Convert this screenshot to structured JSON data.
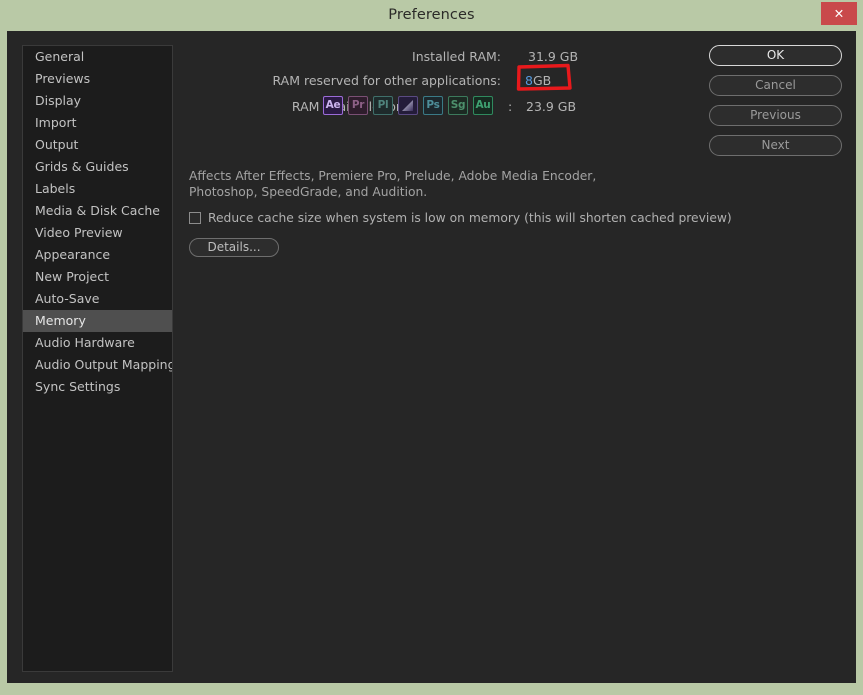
{
  "window": {
    "title": "Preferences",
    "close_label": "✕",
    "titlebar_color": "#b9c9a6",
    "body_color": "#262626"
  },
  "sidebar": {
    "items": [
      {
        "label": "General",
        "selected": false
      },
      {
        "label": "Previews",
        "selected": false
      },
      {
        "label": "Display",
        "selected": false
      },
      {
        "label": "Import",
        "selected": false
      },
      {
        "label": "Output",
        "selected": false
      },
      {
        "label": "Grids & Guides",
        "selected": false
      },
      {
        "label": "Labels",
        "selected": false
      },
      {
        "label": "Media & Disk Cache",
        "selected": false
      },
      {
        "label": "Video Preview",
        "selected": false
      },
      {
        "label": "Appearance",
        "selected": false
      },
      {
        "label": "New Project",
        "selected": false
      },
      {
        "label": "Auto-Save",
        "selected": false
      },
      {
        "label": "Memory",
        "selected": true
      },
      {
        "label": "Audio Hardware",
        "selected": false
      },
      {
        "label": "Audio Output Mapping",
        "selected": false
      },
      {
        "label": "Sync Settings",
        "selected": false
      }
    ]
  },
  "buttons": {
    "ok": "OK",
    "cancel": "Cancel",
    "previous": "Previous",
    "next": "Next"
  },
  "memory": {
    "installed_label": "Installed RAM:",
    "installed_value": "31.9 GB",
    "reserved_label": "RAM reserved for other applications:",
    "reserved_number": "8",
    "reserved_unit": "GB",
    "reserved_number_color": "#5599dd",
    "available_label": "RAM available for",
    "available_colon": ":",
    "available_value": "23.9 GB",
    "app_badges": [
      {
        "name": "after-effects",
        "text": "Ae",
        "border": "#9b6bd8",
        "fill": "#2b1a44",
        "color": "#cbb4ee",
        "active": true,
        "gradient": false
      },
      {
        "name": "premiere-pro",
        "text": "Pr",
        "border": "#7a4f74",
        "fill": "#2e1d2c",
        "color": "#8d6086",
        "active": false,
        "gradient": false
      },
      {
        "name": "prelude",
        "text": "Pl",
        "border": "#3f6f6a",
        "fill": "#1e2a2b",
        "color": "#4f837c",
        "active": false,
        "gradient": false
      },
      {
        "name": "media-encoder",
        "text": "",
        "border": "#5a4a82",
        "fill": "#241c3a",
        "color": "#9a8fc4",
        "active": false,
        "gradient": true
      },
      {
        "name": "photoshop",
        "text": "Ps",
        "border": "#3a7a86",
        "fill": "#1c272c",
        "color": "#4e8e99",
        "active": false,
        "gradient": false
      },
      {
        "name": "speedgrade",
        "text": "Sg",
        "border": "#3c7a5c",
        "fill": "#1c2a23",
        "color": "#4d8f6c",
        "active": false,
        "gradient": false
      },
      {
        "name": "audition",
        "text": "Au",
        "border": "#2f8a5e",
        "fill": "#162a20",
        "color": "#3fa071",
        "active": false,
        "gradient": false
      }
    ],
    "affects_note": "Affects After Effects, Premiere Pro, Prelude, Adobe Media Encoder, Photoshop, SpeedGrade, and Audition.",
    "reduce_cache_label": "Reduce cache size when system is low on memory (this will shorten cached preview)",
    "reduce_cache_checked": false,
    "details_label": "Details..."
  },
  "annotation": {
    "color": "#e8191c",
    "shape": "hand-drawn-rectangle",
    "targets": "reserved-ram-field"
  }
}
